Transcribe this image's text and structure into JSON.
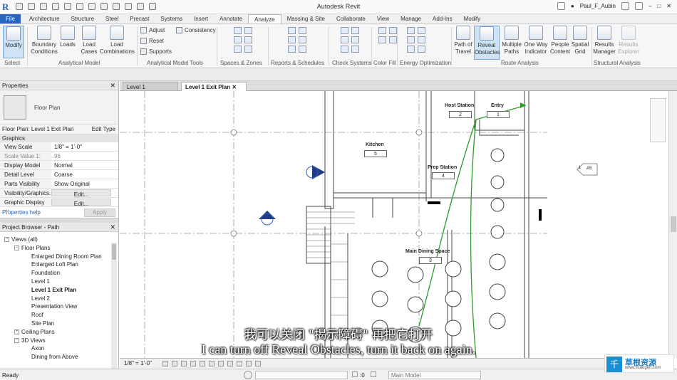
{
  "app": {
    "title": "Autodesk Revit",
    "user": "Paul_F_Aubin"
  },
  "tabs": [
    "File",
    "Architecture",
    "Structure",
    "Steel",
    "Precast",
    "Systems",
    "Insert",
    "Annotate",
    "Analyze",
    "Massing & Site",
    "Collaborate",
    "View",
    "Manage",
    "Add-Ins",
    "Modify"
  ],
  "ribbon": {
    "modify": "Modify",
    "select": "Select",
    "boundary_conditions": [
      "Boundary",
      "Conditions"
    ],
    "loads": "Loads",
    "load_cases": [
      "Load",
      "Cases"
    ],
    "load_combinations": [
      "Load",
      "Combinations"
    ],
    "analytical_model": "Analytical Model",
    "adjust": "Adjust",
    "reset": "Reset",
    "supports": "Supports",
    "consistency": "Consistency",
    "analytical_model_tools": "Analytical Model Tools",
    "spaces_zones": "Spaces & Zones",
    "reports_schedules": "Reports & Schedules",
    "check_systems": "Check Systems",
    "color_fill": "Color Fill",
    "energy_optimization": "Energy Optimization",
    "path_of_travel": [
      "Path of",
      "Travel"
    ],
    "reveal_obstacles": [
      "Reveal",
      "Obstacles"
    ],
    "multiple_paths": [
      "Multiple",
      "Paths"
    ],
    "one_way_indicator": [
      "One Way",
      "Indicator"
    ],
    "people_content": [
      "People",
      "Content"
    ],
    "spatial_grid": [
      "Spatial",
      "Grid"
    ],
    "route_analysis": "Route Analysis",
    "results_manager": [
      "Results",
      "Manager"
    ],
    "results_explorer": [
      "Results",
      "Explorer"
    ],
    "structural_analysis": "Structural Analysis"
  },
  "properties": {
    "title": "Properties",
    "type_name": "Floor Plan",
    "selector": "Floor Plan: Level 1 Exit Plan",
    "edit_type": "Edit Type",
    "group": "Graphics",
    "rows": [
      {
        "k": "View Scale",
        "v": "1/8\" = 1'-0\""
      },
      {
        "k": "Scale Value    1:",
        "v": "96"
      },
      {
        "k": "Display Model",
        "v": "Normal"
      },
      {
        "k": "Detail Level",
        "v": "Coarse"
      },
      {
        "k": "Parts Visibility",
        "v": "Show Original"
      },
      {
        "k": "Visibility/Graphics...",
        "v": "Edit..."
      },
      {
        "k": "Graphic Display ...",
        "v": "Edit..."
      }
    ],
    "help": "Properties help",
    "apply": "Apply"
  },
  "browser": {
    "title": "Project Browser - Path",
    "items": [
      {
        "t": "Views (all)",
        "lvl": 0,
        "tg": "−"
      },
      {
        "t": "Floor Plans",
        "lvl": 1,
        "tg": "−"
      },
      {
        "t": "Enlarged Dining Room Plan",
        "lvl": 2
      },
      {
        "t": "Enlarged Loft Plan",
        "lvl": 2
      },
      {
        "t": "Foundation",
        "lvl": 2
      },
      {
        "t": "Level 1",
        "lvl": 2
      },
      {
        "t": "Level 1 Exit Plan",
        "lvl": 2,
        "sel": true
      },
      {
        "t": "Level 2",
        "lvl": 2
      },
      {
        "t": "Presentation View",
        "lvl": 2
      },
      {
        "t": "Roof",
        "lvl": 2
      },
      {
        "t": "Site Plan",
        "lvl": 2
      },
      {
        "t": "Ceiling Plans",
        "lvl": 1,
        "tg": "+"
      },
      {
        "t": "3D Views",
        "lvl": 1,
        "tg": "−"
      },
      {
        "t": "Axon",
        "lvl": 2
      },
      {
        "t": "Dining from Above",
        "lvl": 2
      }
    ]
  },
  "doc_tabs": [
    "Level 1",
    "Level 1 Exit Plan"
  ],
  "rooms": [
    {
      "name": "Kitchen",
      "num": "5"
    },
    {
      "name": "Prep Station",
      "num": "4"
    },
    {
      "name": "Host Station",
      "num": "2"
    },
    {
      "name": "Entry",
      "num": "1"
    },
    {
      "name": "Main Dining Space",
      "num": "3"
    }
  ],
  "tag_a5": "A5",
  "tag_1": "1",
  "view_scale": "1/8\" = 1'-0\"",
  "status": {
    "ready": "Ready",
    "main_model": "Main Model",
    "zero": ":0"
  },
  "subtitle_cn": "我可以关闭 \"揭示障碍\" 再把它打开",
  "subtitle_en": "I can turn off Reveal Obstacles, turn it back on again.",
  "watermark": {
    "cn": "草根资源",
    "url": "www.5caogen.com"
  },
  "colors": {
    "file_tab": "#2964bd",
    "path_line": "#2e9a2e",
    "selected_tool": "#cfe3f7"
  }
}
